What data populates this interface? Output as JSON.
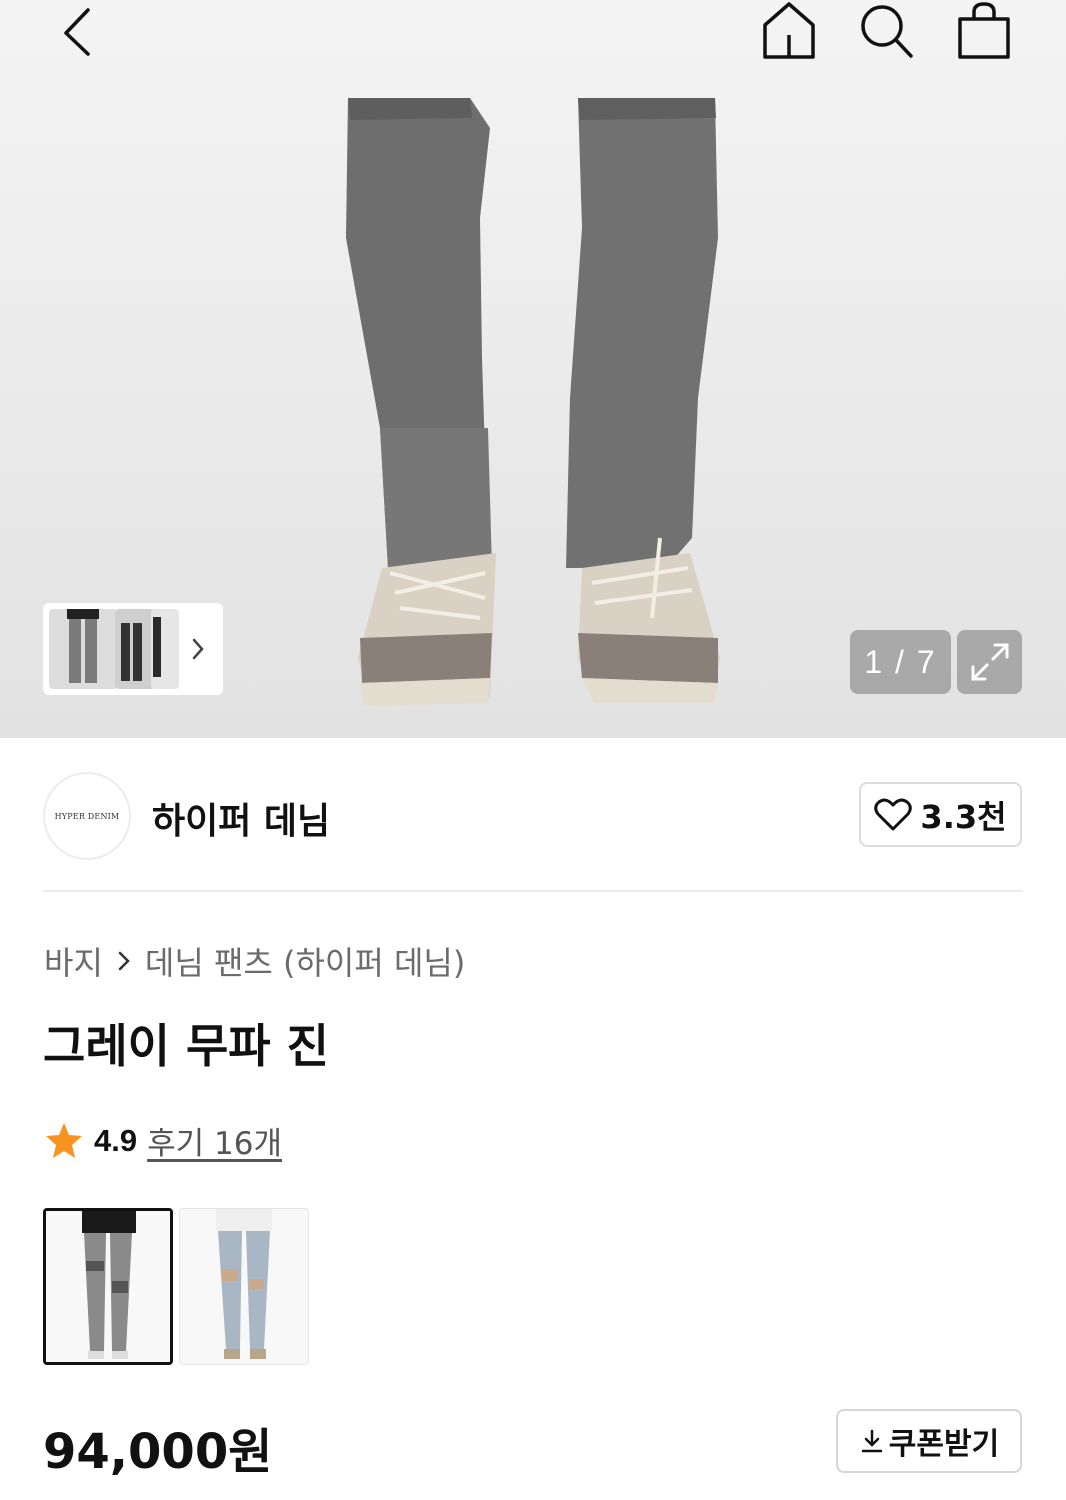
{
  "header": {
    "icons": [
      "back-icon",
      "home-icon",
      "search-icon",
      "shopping-bag-icon"
    ]
  },
  "gallery": {
    "counter": "1 / 7",
    "expand_icon": "expand-icon",
    "thumb_strip_icon": "chevron-right-icon"
  },
  "brand": {
    "logo_text": "HYPER DENIM",
    "name": "하이퍼 데님",
    "like_count": "3.3천",
    "like_icon": "heart-icon"
  },
  "breadcrumb": {
    "category": "바지",
    "subcategory": "데님 팬츠 (하이퍼 데님)"
  },
  "product": {
    "title": "그레이 무파 진",
    "rating": "4.9",
    "review_link": "후기 16개",
    "star_color": "#F7931E",
    "price": "94,000원"
  },
  "coupon": {
    "label": "쿠폰받기",
    "icon": "download-icon"
  }
}
